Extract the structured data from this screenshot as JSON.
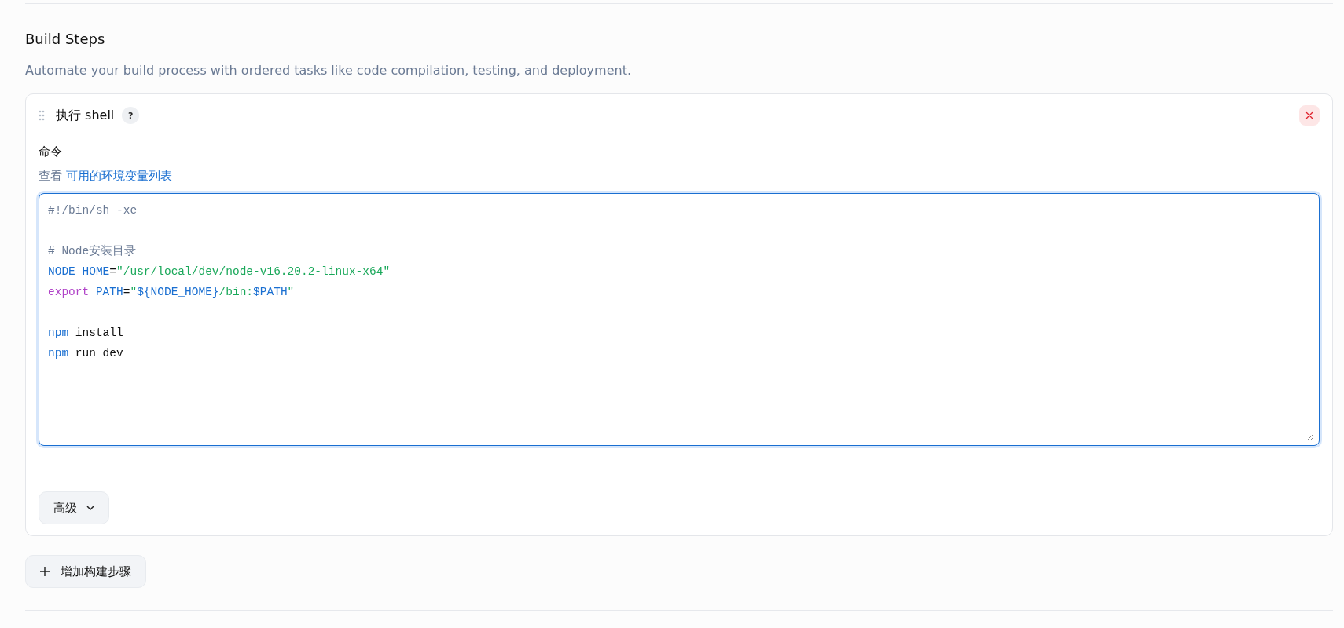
{
  "section": {
    "title": "Build Steps",
    "description": "Automate your build process with ordered tasks like code compilation, testing, and deployment."
  },
  "step": {
    "title": "执行 shell",
    "help": "?",
    "field_label": "命令",
    "hint_prefix": "查看",
    "hint_link": "可用的环境变量列表",
    "editor": {
      "focused": true,
      "lines": [
        {
          "kind": "code",
          "tokens": [
            {
              "kind": "comment",
              "text": "#!/bin/sh -xe"
            }
          ]
        },
        {
          "kind": "blank"
        },
        {
          "kind": "code",
          "tokens": [
            {
              "kind": "comment",
              "text": "# Node安装目录"
            }
          ]
        },
        {
          "kind": "code",
          "tokens": [
            {
              "kind": "variable",
              "text": "NODE_HOME"
            },
            {
              "kind": "plain",
              "text": "="
            },
            {
              "kind": "string",
              "text": "\"/usr/local/dev/node-v16.20.2-linux-x64\""
            }
          ]
        },
        {
          "kind": "code",
          "tokens": [
            {
              "kind": "keyword",
              "text": "export"
            },
            {
              "kind": "variable",
              "text": " PATH"
            },
            {
              "kind": "plain",
              "text": "="
            },
            {
              "kind": "string",
              "text": "\""
            },
            {
              "kind": "variable",
              "text": "${NODE_HOME}"
            },
            {
              "kind": "string",
              "text": "/bin:"
            },
            {
              "kind": "variable",
              "text": "$PATH"
            },
            {
              "kind": "string",
              "text": "\""
            }
          ]
        },
        {
          "kind": "blank"
        },
        {
          "kind": "code",
          "tokens": [
            {
              "kind": "command",
              "text": "npm"
            },
            {
              "kind": "plain",
              "text": " install"
            }
          ]
        },
        {
          "kind": "code",
          "tokens": [
            {
              "kind": "command",
              "text": "npm"
            },
            {
              "kind": "plain",
              "text": " run dev"
            }
          ]
        }
      ]
    },
    "advanced_button": "高级"
  },
  "add_button": "增加构建步骤"
}
